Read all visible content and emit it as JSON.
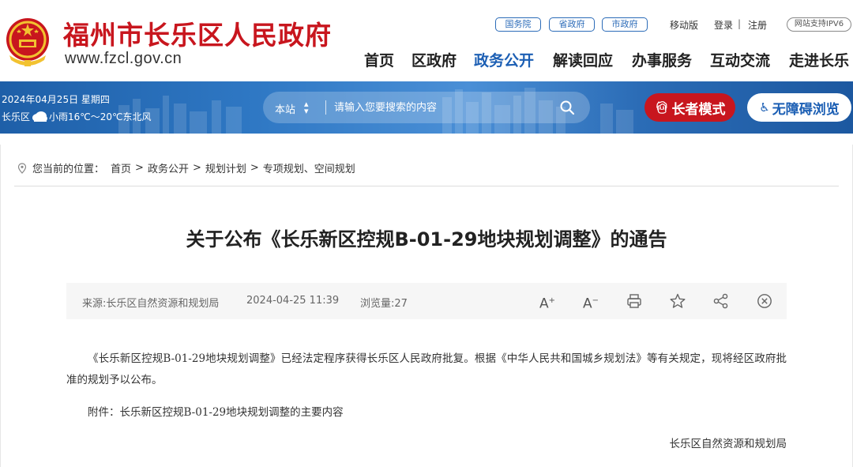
{
  "header": {
    "site_title": "福州市长乐区人民政府",
    "site_domain": "www.fzcl.gov.cn",
    "gov_links": [
      "国务院",
      "省政府",
      "市政府"
    ],
    "mobile_label": "移动版",
    "login_label": "登录",
    "separator": "|",
    "register_label": "注册",
    "ipv6_label": "网站支持IPV6"
  },
  "nav": {
    "items": [
      "首页",
      "区政府",
      "政务公开",
      "解读回应",
      "办事服务",
      "互动交流",
      "走进长乐"
    ],
    "active": "政务公开"
  },
  "banner": {
    "date": "2024年04月25日 星期四",
    "weather_place": "长乐区",
    "weather_desc": "小雨16℃～20℃东北风",
    "search_scope": "本站",
    "search_placeholder": "请输入您要搜索的内容",
    "elder_mode_label": "长者模式",
    "accessible_label": "无障碍浏览"
  },
  "breadcrumb": {
    "prefix": "您当前的位置：",
    "items": [
      "首页",
      "政务公开",
      "规划计划",
      "专项规划、空间规划"
    ],
    "separator": ">"
  },
  "article": {
    "title": "关于公布《长乐新区控规B-01-29地块规划调整》的通告",
    "source": "来源:长乐区自然资源和规划局",
    "date": "2024-04-25 11:39",
    "views": "浏览量:27",
    "tools": {
      "font_larger": "A",
      "font_smaller": "A"
    },
    "paragraph_1": "《长乐新区控规B-01-29地块规划调整》已经法定程序获得长乐区人民政府批复。根据《中华人民共和国城乡规划法》等有关规定，现将经区政府批准的规划予以公布。",
    "paragraph_2": "附件：长乐新区控规B-01-29地块规划调整的主要内容",
    "signature": "长乐区自然资源和规划局"
  },
  "icons": [
    "national-emblem-icon",
    "cloud-rain-icon",
    "search-icon",
    "elder-icon",
    "wheelchair-icon",
    "location-pin-icon",
    "print-icon",
    "star-icon",
    "share-icon",
    "close-icon"
  ],
  "colors": {
    "brand_red": "#c8161e",
    "brand_blue": "#1c5fb4",
    "banner_blue": "#2f78c4"
  }
}
